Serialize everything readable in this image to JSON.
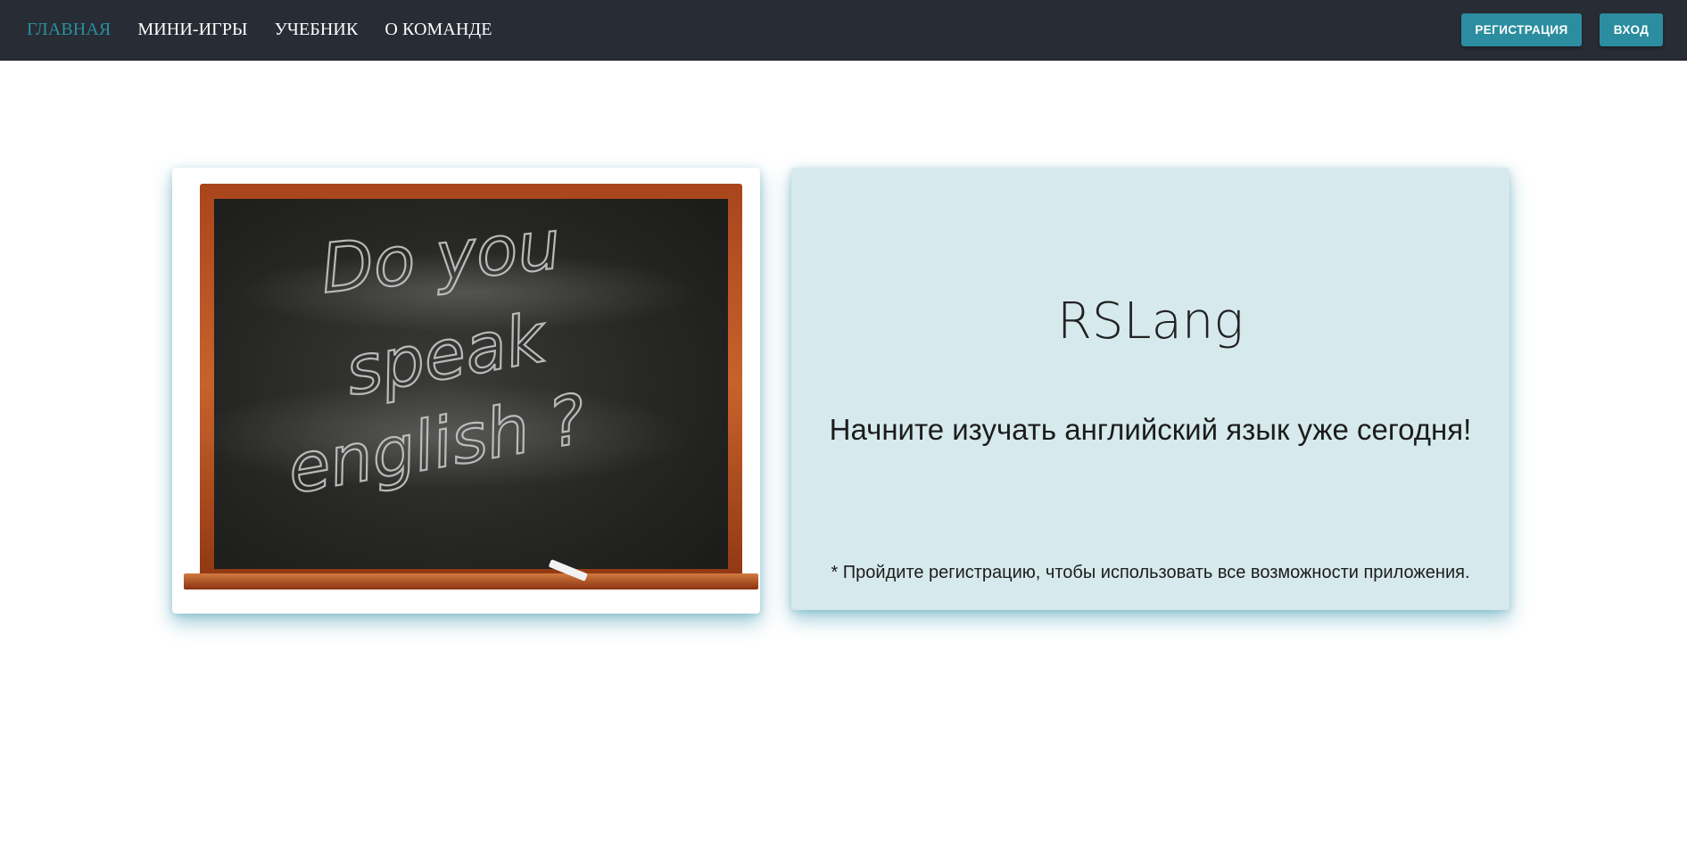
{
  "nav": {
    "items": [
      {
        "label": "ГЛАВНАЯ",
        "active": true
      },
      {
        "label": "МИНИ-ИГРЫ",
        "active": false
      },
      {
        "label": "УЧЕБНИК",
        "active": false
      },
      {
        "label": "О КОМАНДЕ",
        "active": false
      }
    ],
    "register_label": "РЕГИСТРАЦИЯ",
    "login_label": "ВХОД"
  },
  "hero": {
    "image_text_lines": [
      "Do you",
      "speak",
      "english ?"
    ],
    "image_alt": "chalkboard"
  },
  "info": {
    "title": "RSLang",
    "subtitle": "Начните изучать английский язык уже сегодня!",
    "note": "* Пройдите регистрацию, чтобы использовать все возможности приложения."
  },
  "colors": {
    "topbar": "#282c35",
    "accent": "#2b8d9f",
    "active_nav": "#2a8f9e",
    "card_bg": "#d6e9ed"
  }
}
